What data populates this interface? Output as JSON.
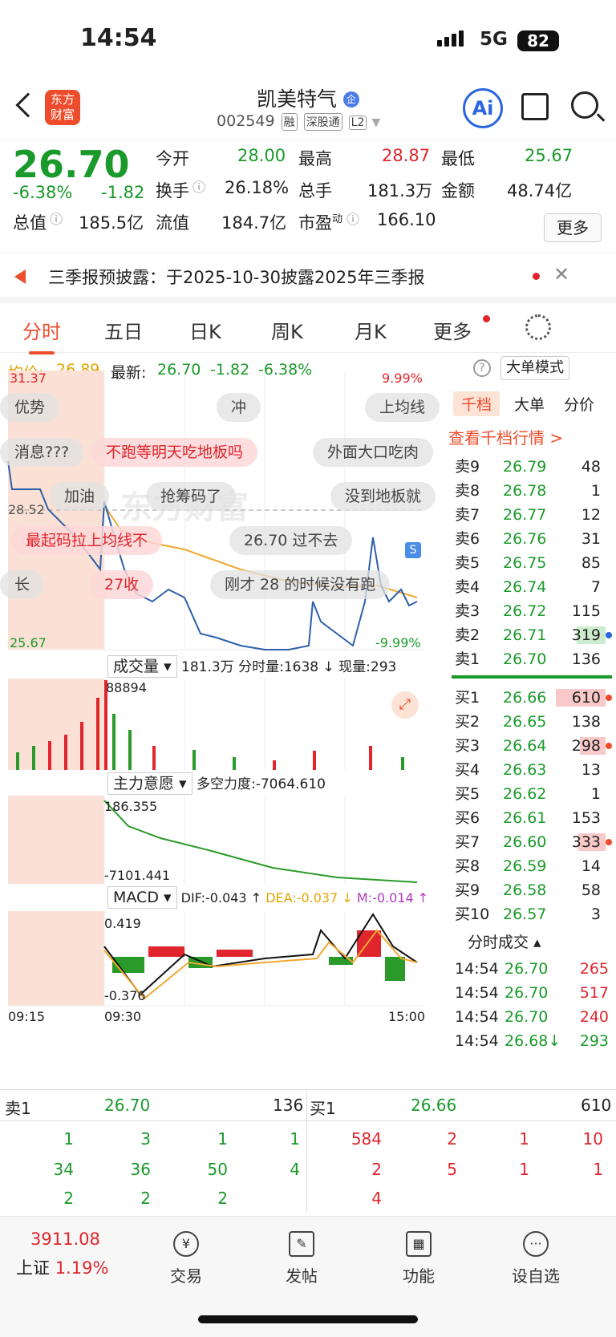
{
  "status_bar": {
    "time": "14:54",
    "network": "5G",
    "battery": "82"
  },
  "header": {
    "logo_text": "东方财富",
    "name": "凯美特气",
    "name_badge": "企",
    "code": "002549",
    "tags": [
      "融",
      "深股通",
      "L2"
    ],
    "ai_label": "Ai",
    "icons": [
      "back-icon",
      "share-icon",
      "search-icon"
    ]
  },
  "quote": {
    "price": "26.70",
    "change_pct": "-6.38%",
    "change": "-1.82",
    "open_label": "今开",
    "open": "28.00",
    "high_label": "最高",
    "high": "28.87",
    "low_label": "最低",
    "low": "25.67",
    "turnover_label": "换手",
    "turnover": "26.18%",
    "volume_label": "总手",
    "volume": "181.3万",
    "amount_label": "金额",
    "amount": "48.74亿",
    "total_cap_label": "总值",
    "total_cap": "185.5亿",
    "float_cap_label": "流值",
    "float_cap": "184.7亿",
    "pe_label": "市盈",
    "pe_sup": "动",
    "pe": "166.10",
    "more_label": "更多"
  },
  "notice": {
    "text": "三季报预披露：于2025-10-30披露2025年三季报"
  },
  "tabs": [
    "分时",
    "五日",
    "日K",
    "周K",
    "月K",
    "更多"
  ],
  "avg_bar": {
    "avg_label": "均价:",
    "avg": "26.89",
    "latest_label": "最新:",
    "latest": "26.70",
    "change": "-1.82",
    "change_pct": "-6.38%",
    "mode_label": "大单模式"
  },
  "main_chart": {
    "high_label": "31.37",
    "high_pct": "9.99%",
    "mid_label": "28.52",
    "low_label": "25.67",
    "low_pct": "-9.99%",
    "watermark": "东方财富",
    "danmaku": [
      "优势",
      "冲",
      "上均线",
      "消息???",
      "不跑等明天吃地板吗",
      "外面大口吃肉",
      "加油",
      "抢筹码了",
      "没到地板就",
      "最起码拉上均线不",
      "26.70 过不去",
      "长",
      "27收",
      "刚才 28 的时候没有跑"
    ],
    "marker": "S"
  },
  "volume_panel": {
    "label": "成交量",
    "total": "181.3万",
    "min_vol_label": "分时量:",
    "min_vol": "1638",
    "cur_vol_label": "现量:",
    "cur_vol": "293",
    "max": "88894"
  },
  "force_panel": {
    "label": "主力意愿",
    "force_label": "多空力度:",
    "force": "-7064.610",
    "max": "186.355",
    "min": "-7101.441"
  },
  "macd_panel": {
    "label": "MACD",
    "dif": "DIF:-0.043 ↑",
    "dea": "DEA:-0.037 ↓",
    "m": "M:-0.014 ↑",
    "max": "0.419",
    "min": "-0.376"
  },
  "time_axis": [
    "09:15",
    "09:30",
    "15:00"
  ],
  "order_book": {
    "tabs": [
      "千档",
      "大单",
      "分价"
    ],
    "link": "查看千档行情 >",
    "asks": [
      {
        "label": "卖9",
        "price": "26.79",
        "vol": "48"
      },
      {
        "label": "卖8",
        "price": "26.78",
        "vol": "1"
      },
      {
        "label": "卖7",
        "price": "26.77",
        "vol": "12"
      },
      {
        "label": "卖6",
        "price": "26.76",
        "vol": "31"
      },
      {
        "label": "卖5",
        "price": "26.75",
        "vol": "85"
      },
      {
        "label": "卖4",
        "price": "26.74",
        "vol": "7"
      },
      {
        "label": "卖3",
        "price": "26.72",
        "vol": "115"
      },
      {
        "label": "卖2",
        "price": "26.71",
        "vol": "319"
      },
      {
        "label": "卖1",
        "price": "26.70",
        "vol": "136"
      }
    ],
    "bids": [
      {
        "label": "买1",
        "price": "26.66",
        "vol": "610"
      },
      {
        "label": "买2",
        "price": "26.65",
        "vol": "138"
      },
      {
        "label": "买3",
        "price": "26.64",
        "vol": "298"
      },
      {
        "label": "买4",
        "price": "26.63",
        "vol": "13"
      },
      {
        "label": "买5",
        "price": "26.62",
        "vol": "1"
      },
      {
        "label": "买6",
        "price": "26.61",
        "vol": "153"
      },
      {
        "label": "买7",
        "price": "26.60",
        "vol": "333"
      },
      {
        "label": "买8",
        "price": "26.59",
        "vol": "14"
      },
      {
        "label": "买9",
        "price": "26.58",
        "vol": "58"
      },
      {
        "label": "买10",
        "price": "26.57",
        "vol": "3"
      }
    ],
    "ticks_title": "分时成交",
    "ticks": [
      {
        "time": "14:54",
        "price": "26.70",
        "vol": "265"
      },
      {
        "time": "14:54",
        "price": "26.70",
        "vol": "517"
      },
      {
        "time": "14:54",
        "price": "26.70",
        "vol": "240"
      },
      {
        "time": "14:54",
        "price": "26.68↓",
        "vol": "293"
      }
    ]
  },
  "bottom_table": {
    "sell1": {
      "label": "卖1",
      "price": "26.70",
      "vol": "136"
    },
    "buy1": {
      "label": "买1",
      "price": "26.66",
      "vol": "610"
    },
    "sell_queue": [
      "1",
      "3",
      "1",
      "1",
      "34",
      "36",
      "50",
      "4",
      "2",
      "2",
      "2"
    ],
    "buy_queue": [
      "584",
      "2",
      "1",
      "10",
      "2",
      "5",
      "1",
      "1",
      "4"
    ]
  },
  "dock": {
    "index_value": "3911.08",
    "index_name": "上证",
    "index_pct": "1.19%",
    "items": [
      "交易",
      "发帖",
      "功能",
      "设自选"
    ]
  }
}
